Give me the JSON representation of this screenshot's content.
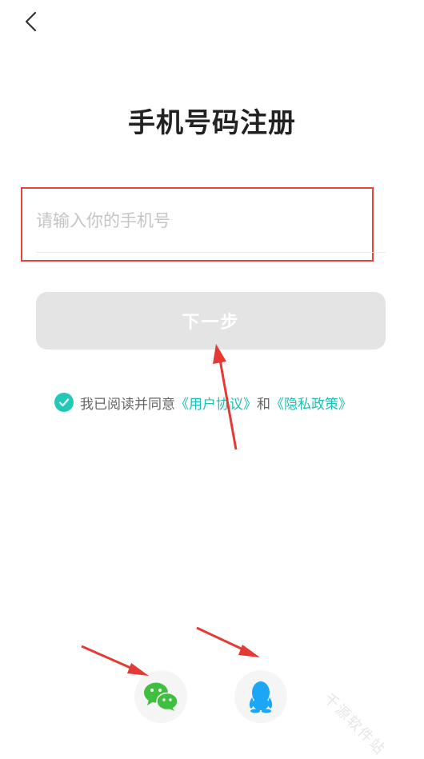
{
  "header": {
    "back_icon": "chevron-left-icon"
  },
  "title": "手机号码注册",
  "phone": {
    "placeholder": "请输入你的手机号",
    "value": ""
  },
  "next_button": {
    "label": "下一步"
  },
  "agreement": {
    "checked": true,
    "prefix": "我已阅读并同意",
    "user_agreement": "《用户协议》",
    "conjunction": "和",
    "privacy_policy": "《隐私政策》"
  },
  "social_login": {
    "wechat_icon": "wechat-icon",
    "qq_icon": "qq-icon"
  },
  "watermark": "千源软件站",
  "colors": {
    "accent": "#1fbfb5",
    "check": "#22c9b8",
    "highlight_box": "#e0463f",
    "annotation_arrow": "#e53935",
    "wechat_green": "#3fbf3f",
    "qq_blue": "#1ba7f5",
    "button_disabled": "#e4e4e4"
  }
}
